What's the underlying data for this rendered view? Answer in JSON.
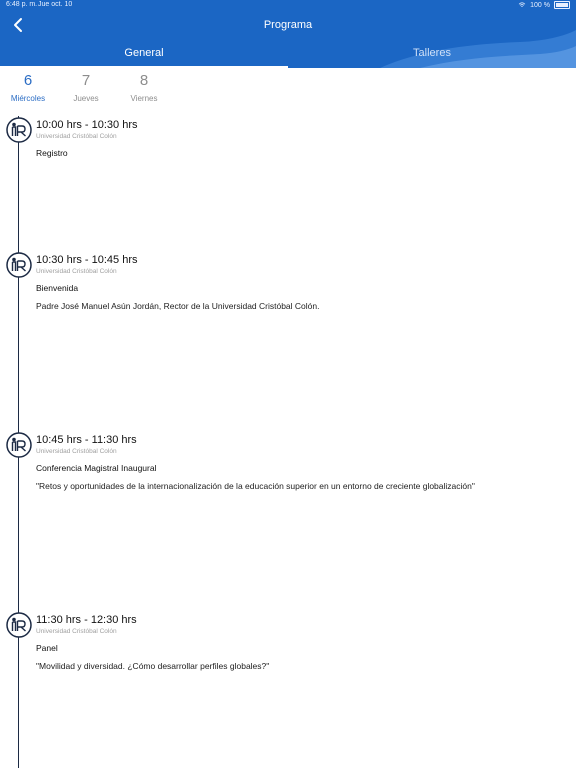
{
  "status_bar": {
    "time": "6:48 p. m.",
    "date": "Jue oct. 10",
    "battery": "100 %"
  },
  "header": {
    "title": "Programa"
  },
  "tabs": [
    {
      "label": "General",
      "active": true
    },
    {
      "label": "Talleres",
      "active": false
    }
  ],
  "days": [
    {
      "number": "6",
      "name": "Miércoles",
      "active": true
    },
    {
      "number": "7",
      "name": "Jueves",
      "active": false
    },
    {
      "number": "8",
      "name": "Viernes",
      "active": false
    }
  ],
  "events": [
    {
      "time": "10:00 hrs - 10:30 hrs",
      "location": "Universidad Cristóbal Colón",
      "title": "Registro",
      "description": ""
    },
    {
      "time": "10:30 hrs - 10:45 hrs",
      "location": "Universidad Cristóbal Colón",
      "title": "Bienvenida",
      "description": "Padre José Manuel Asún Jordán, Rector de la Universidad Cristóbal Colón."
    },
    {
      "time": "10:45 hrs - 11:30 hrs",
      "location": "Universidad Cristóbal Colón",
      "title": "Conferencia Magistral Inaugural",
      "description": "\"Retos y oportunidades de la internacionalización de la educación superior en un entorno de creciente globalización\""
    },
    {
      "time": "11:30 hrs - 12:30 hrs",
      "location": "Universidad Cristóbal Colón",
      "title": "Panel",
      "description": "\"Movilidad y diversidad. ¿Cómo desarrollar perfiles globales?\""
    }
  ],
  "colors": {
    "header": "#1b66c4",
    "active_day": "#2a6cc4",
    "timeline": "#1c2a44"
  },
  "icons": {
    "back": "chevron-left-icon",
    "event": "speaker-podium-icon"
  }
}
